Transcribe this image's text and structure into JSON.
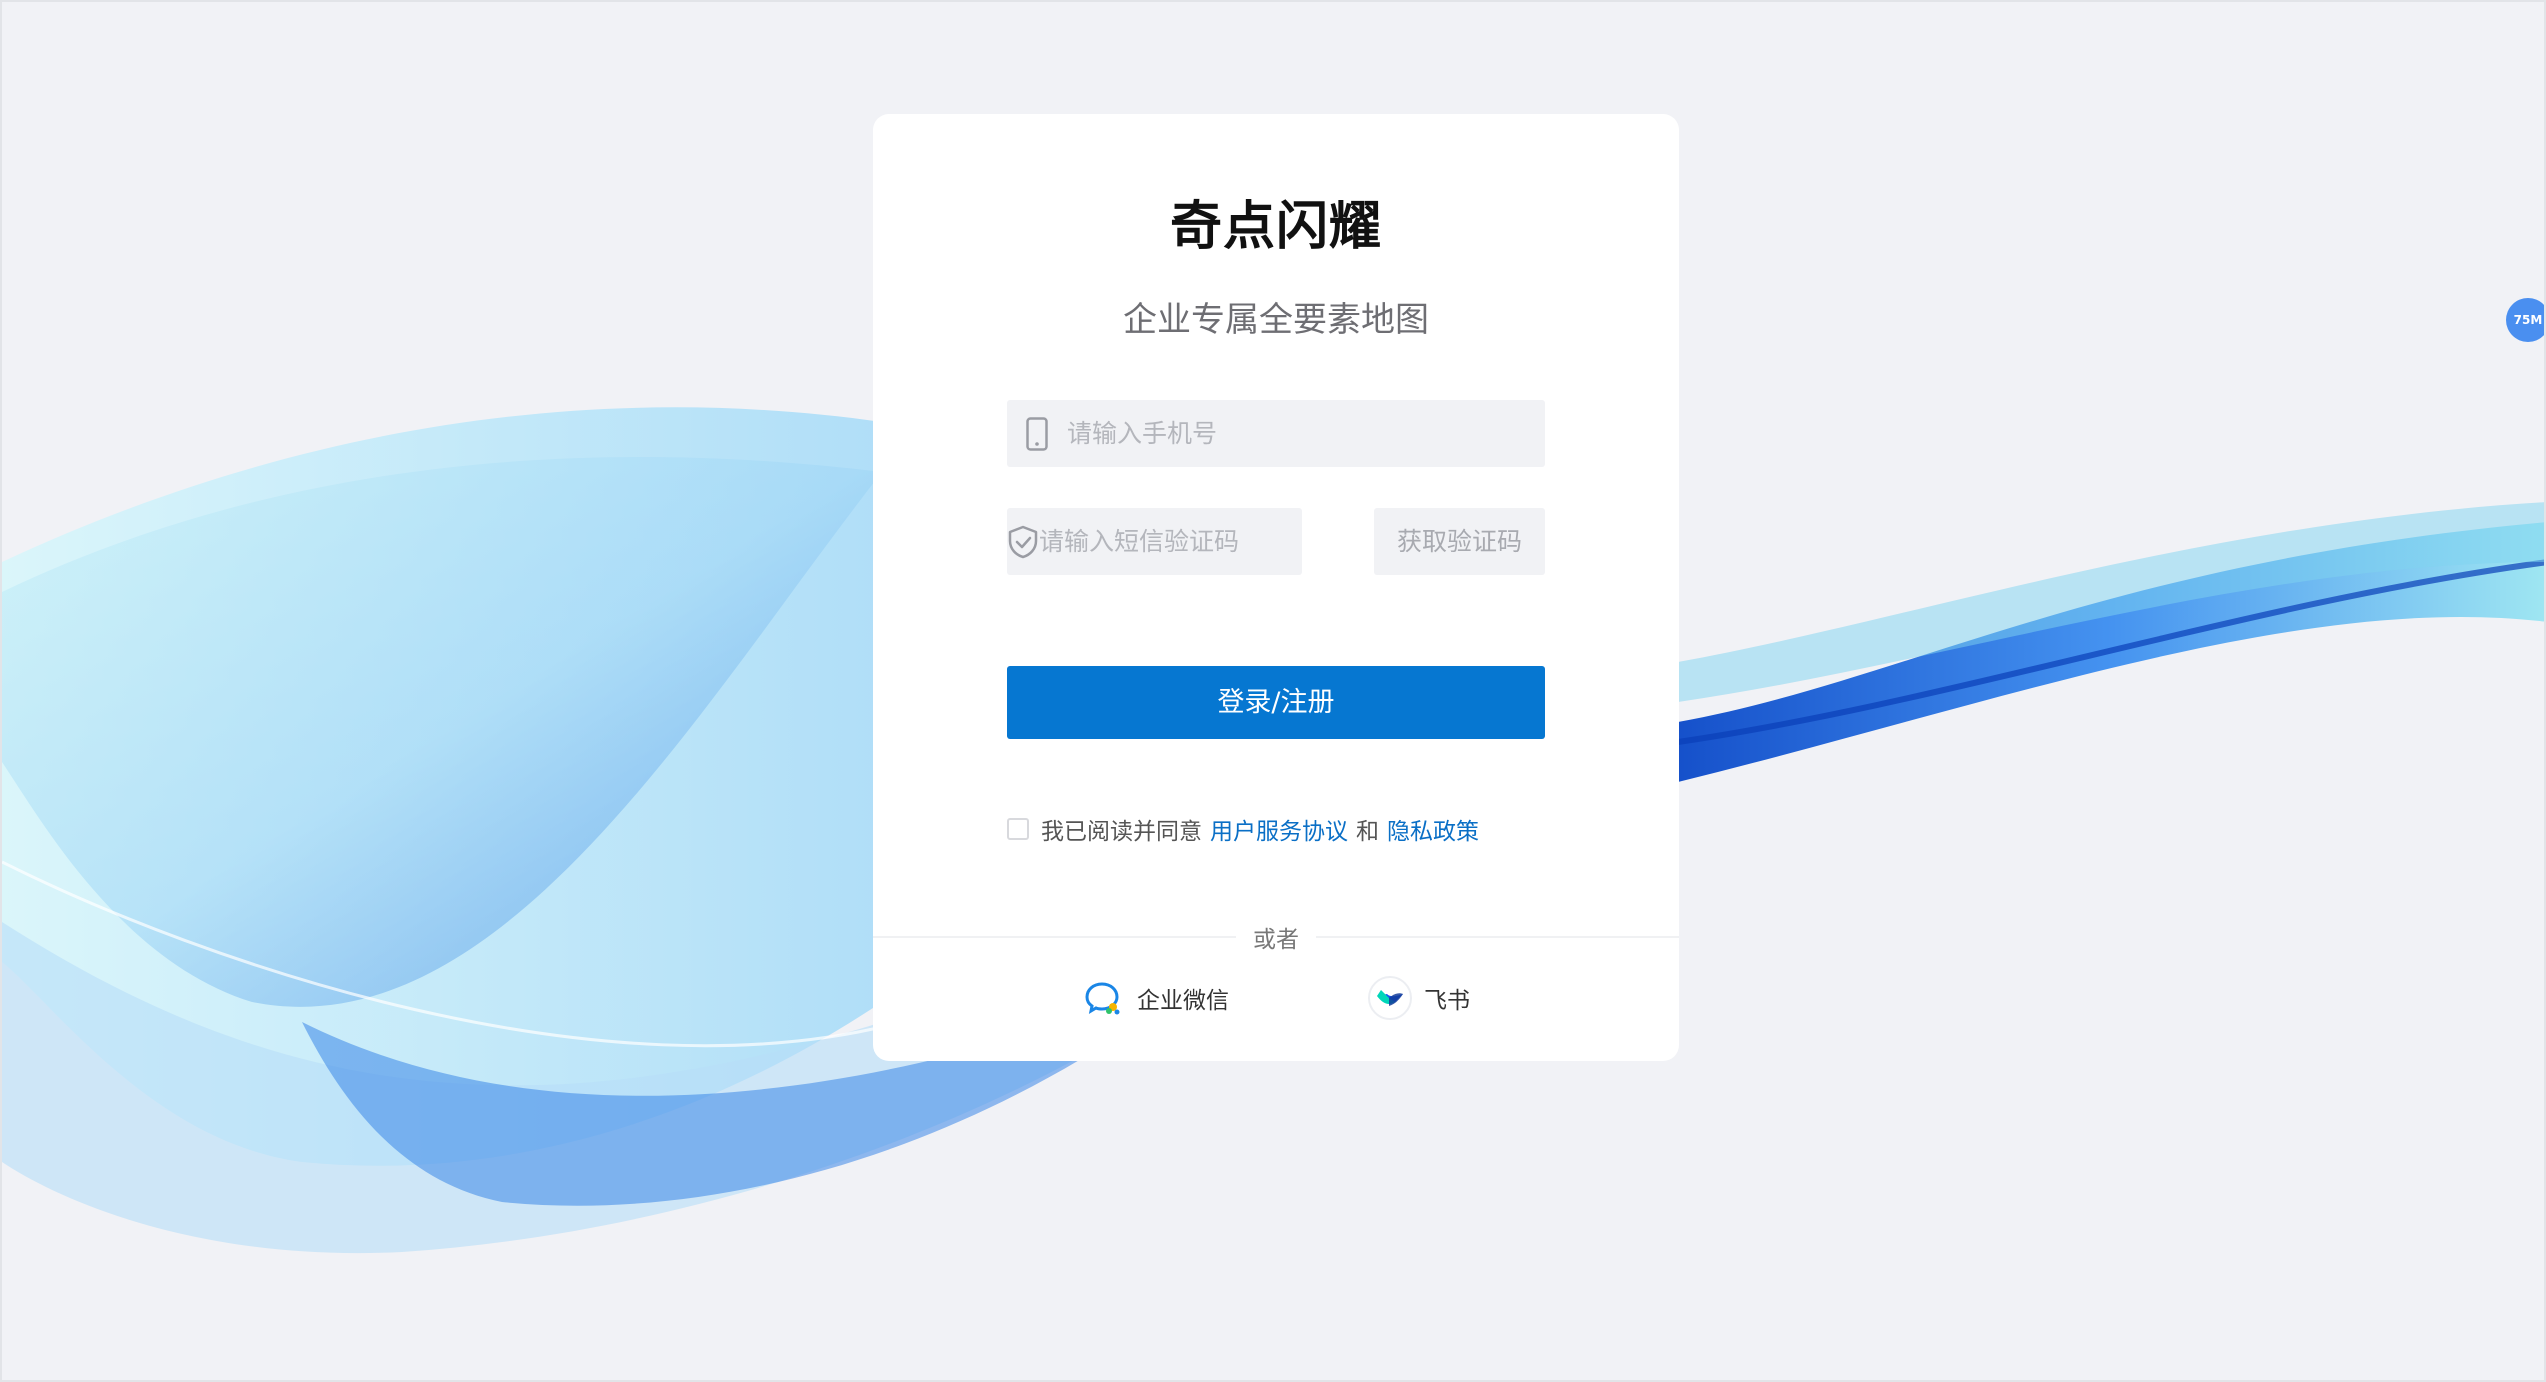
{
  "brand": {
    "name": "奇点闪耀",
    "subtitle": "企业专属全要素地图"
  },
  "login": {
    "phone_placeholder": "请输入手机号",
    "code_placeholder": "请输入短信验证码",
    "get_code_label": "获取验证码",
    "submit_label": "登录/注册"
  },
  "agreement": {
    "prefix": "我已阅读并同意",
    "terms_label": "用户服务协议",
    "and": "和",
    "privacy_label": "隐私政策"
  },
  "divider_label": "或者",
  "sso": {
    "wecom_label": "企业微信",
    "feishu_label": "飞书"
  },
  "badge": {
    "label": "75M"
  },
  "colors": {
    "primary": "#0677d1",
    "link": "#0a6fc6",
    "background": "#f1f2f6",
    "input_bg": "#f1f2f5"
  }
}
